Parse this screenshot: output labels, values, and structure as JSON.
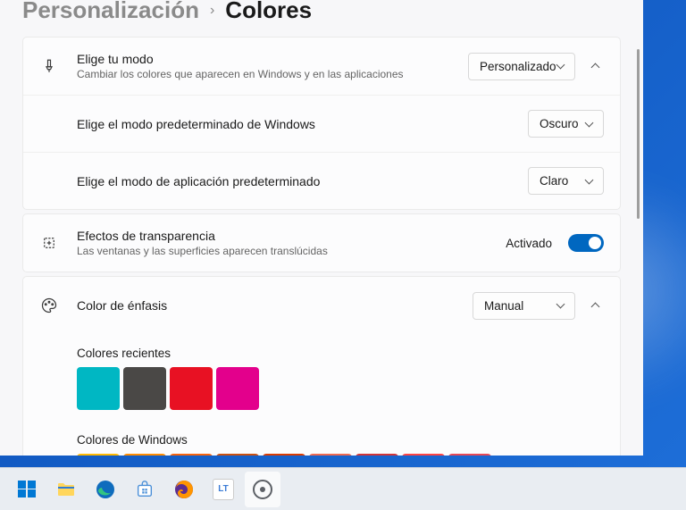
{
  "breadcrumb": {
    "parent": "Personalización",
    "current": "Colores"
  },
  "mode": {
    "title": "Elige tu modo",
    "subtitle": "Cambiar los colores que aparecen en Windows y en las aplicaciones",
    "value": "Personalizado",
    "windows_mode_label": "Elige el modo predeterminado de Windows",
    "windows_mode_value": "Oscuro",
    "app_mode_label": "Elige el modo de aplicación predeterminado",
    "app_mode_value": "Claro"
  },
  "transparency": {
    "title": "Efectos de transparencia",
    "subtitle": "Las ventanas y las superficies aparecen translúcidas",
    "status": "Activado",
    "on": true
  },
  "accent": {
    "title": "Color de énfasis",
    "value": "Manual",
    "recent_label": "Colores recientes",
    "recent_colors": [
      "#00b7c3",
      "#4a4846",
      "#e81123",
      "#e3008c"
    ],
    "windows_label": "Colores de Windows",
    "windows_colors": [
      "#ffb900",
      "#ff8c00",
      "#f7630c",
      "#ca5010",
      "#da3b01",
      "#ef6950",
      "#d13438",
      "#ff4343",
      "#e74856"
    ]
  },
  "taskbar": {
    "items": [
      {
        "name": "start",
        "active": false
      },
      {
        "name": "file-explorer",
        "active": false
      },
      {
        "name": "edge",
        "active": false
      },
      {
        "name": "store",
        "active": false
      },
      {
        "name": "firefox",
        "active": false
      },
      {
        "name": "languagetool",
        "active": false
      },
      {
        "name": "settings",
        "active": true
      }
    ]
  }
}
